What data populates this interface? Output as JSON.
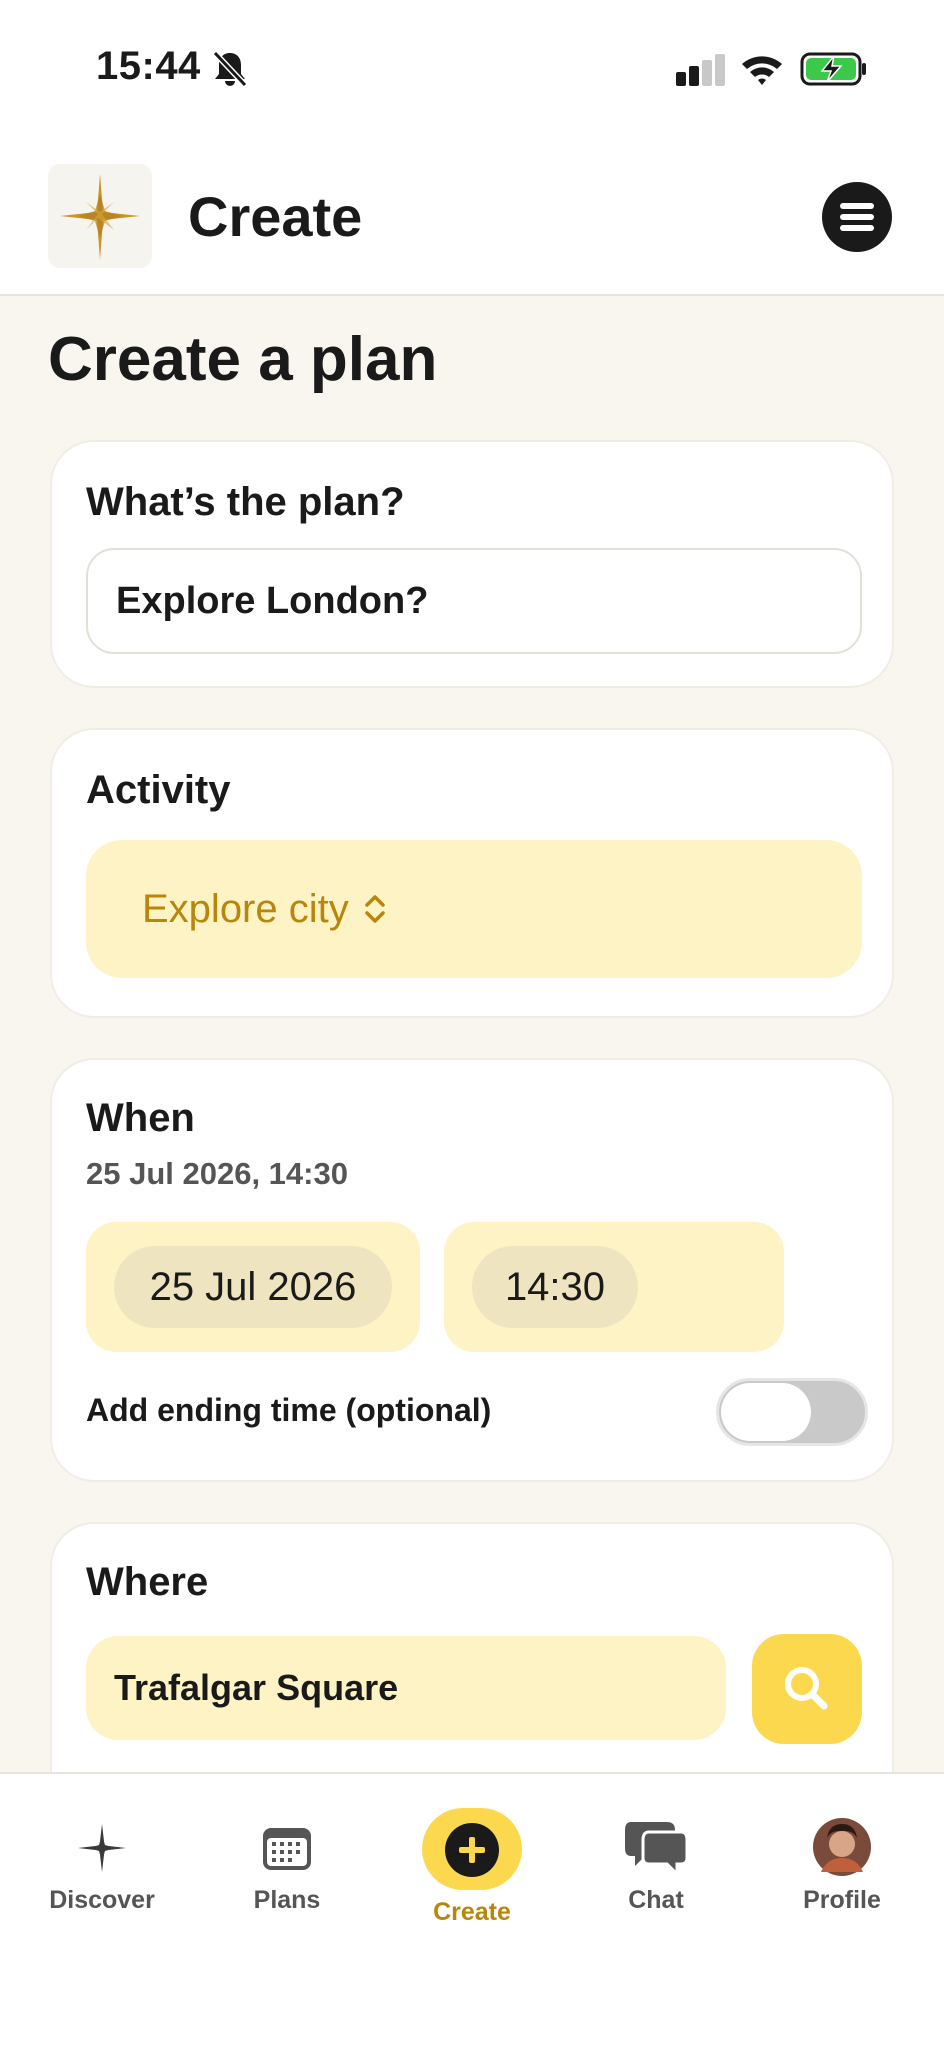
{
  "status_bar": {
    "time": "15:44"
  },
  "header": {
    "title": "Create"
  },
  "page": {
    "title": "Create a plan"
  },
  "plan_card": {
    "label": "What’s the plan?",
    "input_value": "Explore London?"
  },
  "activity_card": {
    "label": "Activity",
    "selected": "Explore city"
  },
  "when_card": {
    "label": "When",
    "summary": "25 Jul 2026, 14:30",
    "date": "25 Jul 2026",
    "time": "14:30",
    "end_time_label": "Add ending time (optional)",
    "end_time_enabled": false
  },
  "where_card": {
    "label": "Where",
    "input_value": "Trafalgar Square"
  },
  "tabs": [
    {
      "label": "Discover",
      "icon": "sparkle-icon"
    },
    {
      "label": "Plans",
      "icon": "calendar-icon"
    },
    {
      "label": "Create",
      "icon": "plus-icon",
      "active": true
    },
    {
      "label": "Chat",
      "icon": "chat-bubbles-icon"
    },
    {
      "label": "Profile",
      "icon": "avatar"
    }
  ],
  "colors": {
    "accent": "#fcd84f",
    "accent_soft": "#fdf3c4",
    "accent_text": "#b8860b",
    "background": "#f8f6ef"
  }
}
